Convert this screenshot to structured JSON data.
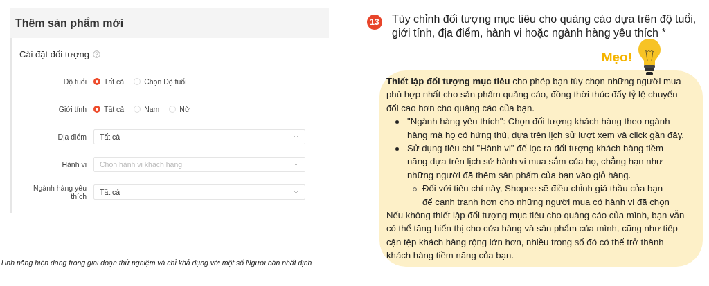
{
  "screenshot": {
    "title": "Thêm sản phẩm mới",
    "section": {
      "title": "Cài đặt đối tượng",
      "fields": [
        {
          "kind": "radio",
          "label": "Độ tuổi",
          "options": [
            {
              "label": "Tất cả",
              "selected": true
            },
            {
              "label": "Chọn Độ tuổi",
              "selected": false
            }
          ]
        },
        {
          "kind": "radio",
          "label": "Giới tính",
          "options": [
            {
              "label": "Tất cả",
              "selected": true
            },
            {
              "label": "Nam",
              "selected": false
            },
            {
              "label": "Nữ",
              "selected": false
            }
          ]
        },
        {
          "kind": "select",
          "label": "Địa điểm",
          "value": "Tất cả"
        },
        {
          "kind": "select",
          "label": "Hành vi",
          "placeholder": "Chọn hành vi khách hàng"
        },
        {
          "kind": "select",
          "label": "Ngành hàng yêu thích",
          "value": "Tất cả"
        }
      ]
    }
  },
  "footnote": "Tính năng hiện đang trong giai đoạn thử nghiệm và chỉ khả dụng với một số Người bán nhất định",
  "step": {
    "number": "13",
    "text": "Tùy chỉnh đối tượng mục tiêu cho quảng cáo dựa trên độ tuổi, giới tính, địa điểm, hành vi hoặc ngành hàng yêu thích *"
  },
  "tip": {
    "label": "Mẹo!",
    "intro": "**Thiết lập đối tượng mục tiêu** cho phép bạn tùy chọn những người mua phù hợp nhất cho sản phẩm quảng cáo, đồng thời thúc đẩy tỷ lệ chuyển đổi cao hơn cho quảng cáo của bạn.",
    "bullets": [
      {
        "text": "\"Ngành hàng yêu thích\": Chọn đối tượng khách hàng theo ngành hàng mà họ có hứng thú, dựa trên lịch sử lượt xem và click gần đây."
      },
      {
        "text": "Sử dụng tiêu chí \"Hành vi\" để lọc ra đối tượng khách hàng tiềm năng dựa trên lịch sử hành vi mua sắm của họ, chẳng hạn như những người đã thêm sản phẩm của bạn vào giỏ hàng.",
        "children": [
          {
            "text": "Đối với tiêu chí này, Shopee sẽ điều chỉnh giá thầu của bạn để cạnh tranh hơn cho những người mua có hành vi đã chọn"
          }
        ]
      }
    ],
    "outro": "Nếu không thiết lập đối tượng mục tiêu cho quảng cáo của mình, bạn vẫn có thể tăng hiển thị cho cửa hàng và sản phẩm của mình, cũng như tiếp cận tệp khách hàng rộng lớn hơn, nhiều trong số đó có thể trở thành khách hàng tiềm năng của bạn."
  }
}
